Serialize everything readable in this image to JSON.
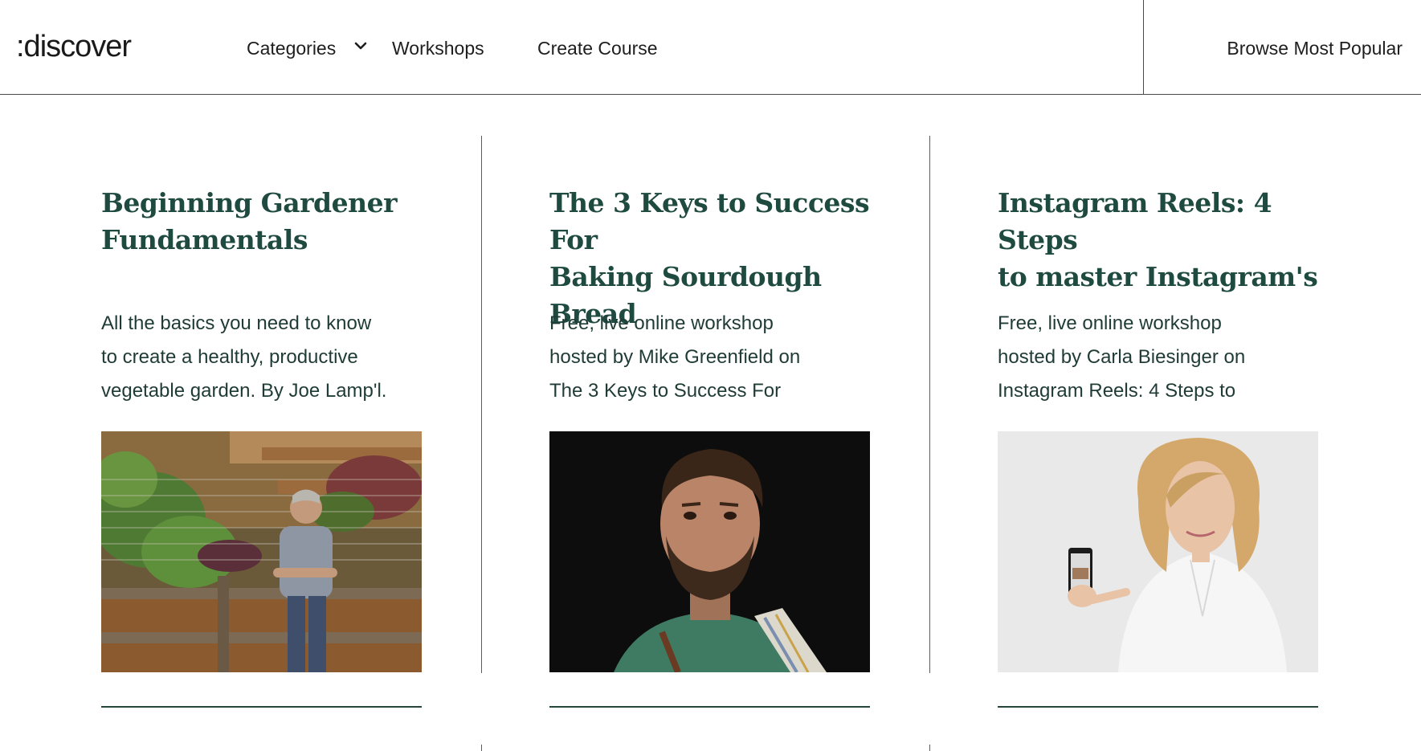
{
  "header": {
    "logo": ":discover",
    "nav": {
      "categories": "Categories",
      "workshops": "Workshops",
      "create_course": "Create Course",
      "browse_popular": "Browse Most Popular"
    }
  },
  "cards": [
    {
      "title_line1": "Beginning Gardener",
      "title_line2": "Fundamentals",
      "desc_line1": "All the basics you need to know",
      "desc_line2": "to create a healthy, productive",
      "desc_line3": "vegetable garden. By Joe Lamp'l."
    },
    {
      "title_line1": "The 3 Keys to Success For",
      "title_line2": "Baking Sourdough Bread",
      "desc_line1": "Free, live online workshop",
      "desc_line2": "hosted by Mike Greenfield on",
      "desc_line3": "The 3 Keys to Success For"
    },
    {
      "title_line1": "Instagram Reels: 4 Steps",
      "title_line2": "to master Instagram's",
      "desc_line1": "Free, live online workshop",
      "desc_line2": "hosted by Carla Biesinger on",
      "desc_line3": "Instagram Reels: 4 Steps to"
    }
  ],
  "icons": {
    "categories_chevron": "chevron-down-icon"
  },
  "colors": {
    "title": "#1f4a40",
    "text": "#1f3b35",
    "divider": "#3f6b5e"
  }
}
